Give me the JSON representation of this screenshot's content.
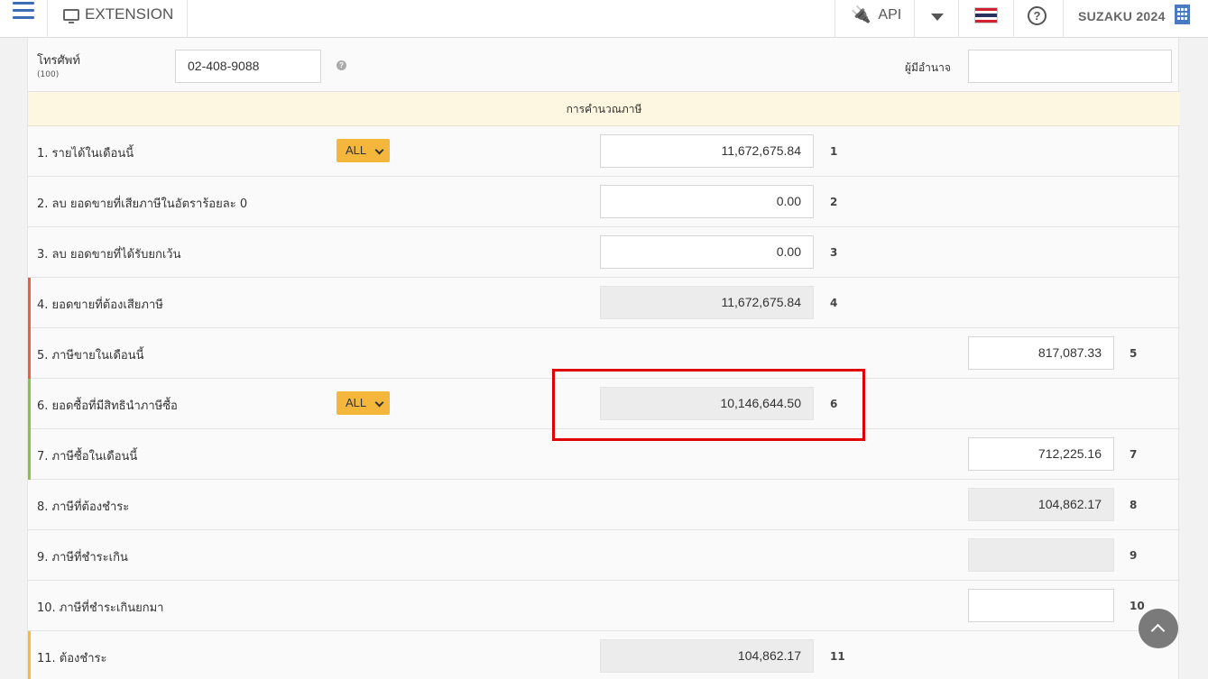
{
  "topbar": {
    "extension_label": "EXTENSION",
    "api_label": "API",
    "brand": "SUZAKU 2024"
  },
  "icons": [
    "menu-icon",
    "monitor-icon",
    "plug-icon",
    "caret-down-icon",
    "thai-flag-icon",
    "help-icon",
    "building-icon",
    "arrow-up-icon"
  ],
  "form": {
    "phone_label": "โทรศัพท์",
    "phone_sub": "(100)",
    "phone_value": "02-408-9088",
    "authorized_label": "ผู้มีอำนาจ",
    "authorized_value": "",
    "section_title": "การคำนวณภาษี"
  },
  "rows": [
    {
      "label": "1. รายได้ในเดือนนี้",
      "dropdown": "ALL",
      "value": "11,672,675.84",
      "ref": "1"
    },
    {
      "label": "2. ลบ ยอดขายที่เสียภาษีในอัตราร้อยละ 0",
      "value": "0.00",
      "ref": "2"
    },
    {
      "label": "3. ลบ ยอดขายที่ได้รับยกเว้น",
      "value": "0.00",
      "ref": "3"
    },
    {
      "label": "4. ยอดขายที่ต้องเสียภาษี",
      "value": "11,672,675.84",
      "ref": "4"
    },
    {
      "label": "5. ภาษีขายในเดือนนี้",
      "value": "817,087.33",
      "ref": "5"
    },
    {
      "label": "6. ยอดซื้อที่มีสิทธินำภาษีซื้อ",
      "dropdown": "ALL",
      "value": "10,146,644.50",
      "ref": "6"
    },
    {
      "label": "7. ภาษีซื้อในเดือนนี้",
      "value": "712,225.16",
      "ref": "7"
    },
    {
      "label": "8. ภาษีที่ต้องชำระ",
      "value": "104,862.17",
      "ref": "8"
    },
    {
      "label": "9. ภาษีที่ชำระเกิน",
      "value": "",
      "ref": "9"
    },
    {
      "label": "10. ภาษีที่ชำระเกินยกมา",
      "value": "",
      "ref": "10"
    },
    {
      "label": "11. ต้องชำระ",
      "value": "104,862.17",
      "ref": "11"
    }
  ],
  "colors": {
    "accent_red": "#e8604c",
    "accent_green": "#8cc152",
    "accent_yellow": "#f6bb42",
    "highlight": "#e00000",
    "dropdown": "#f4b73c"
  }
}
